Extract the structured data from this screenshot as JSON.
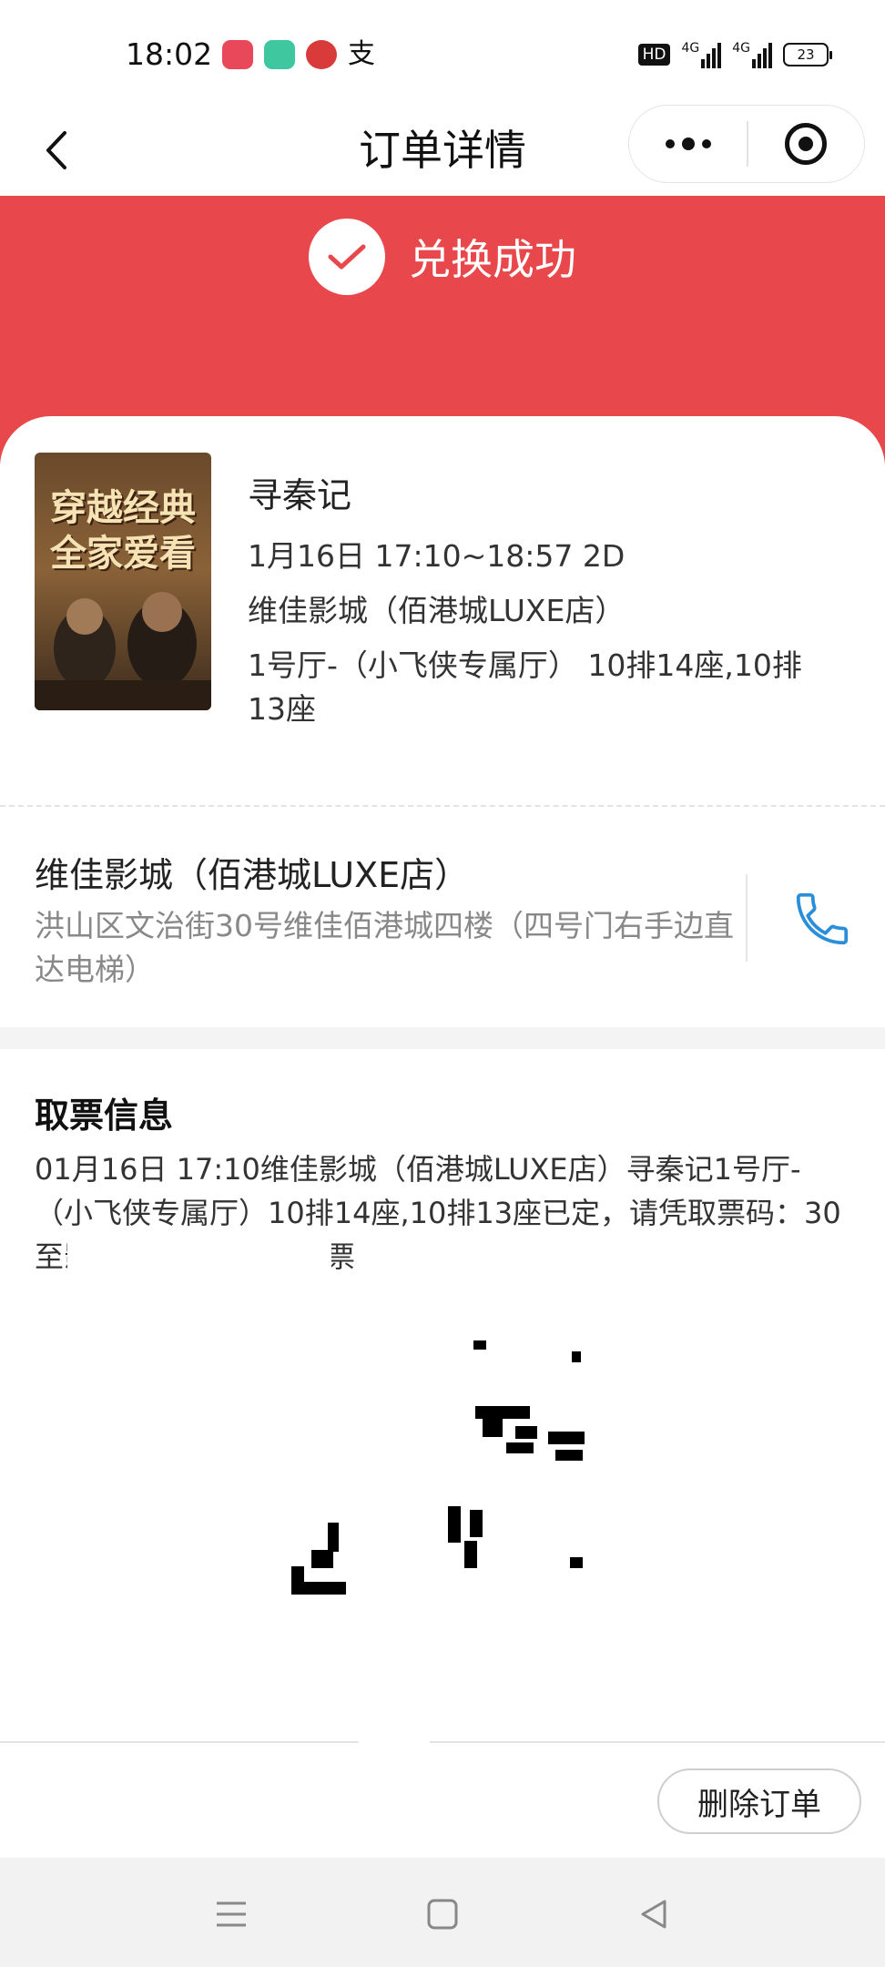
{
  "status_bar": {
    "time": "18:02",
    "notification_icons": [
      "video-app-icon",
      "message-app-icon",
      "bank-app-icon",
      "alipay-icon"
    ],
    "alipay_glyph": "支",
    "hd_label": "HD",
    "network_1": "4G",
    "network_2": "4G",
    "battery": "23"
  },
  "nav": {
    "title": "订单详情",
    "back_icon": "chevron-left-icon",
    "more_icon": "more-dots-icon",
    "close_icon": "target-icon"
  },
  "banner": {
    "status_text": "兑换成功",
    "background": "#e8474b",
    "check_color": "#e8474b"
  },
  "movie": {
    "poster_lines": [
      "穿越经典",
      "全家爱看"
    ],
    "title": "寻秦记",
    "showtime": "1月16日 17:10~18:57 2D",
    "cinema": "维佳影城（佰港城LUXE店）",
    "hall_seats": "1号厅-（小飞侠专属厅） 10排14座,10排13座"
  },
  "cinema": {
    "name": "维佳影城（佰港城LUXE店）",
    "address": "洪山区文治街30号维佳佰港城四楼（四号门右手边直达电梯）",
    "phone_icon": "phone-icon",
    "phone_color": "#2a8fd8"
  },
  "ticket": {
    "heading": "取票信息",
    "message": "01月16日 17:10维佳影城（佰港城LUXE店）寻秦记1号厅-（小飞侠专属厅）10排14座,10排13座已定，请凭取票码：30 至影城自助机或前台取票"
  },
  "actions": {
    "delete_label": "删除订单"
  },
  "system_nav": {
    "menu_icon": "menu-icon",
    "home_icon": "square-home-icon",
    "back_icon": "triangle-back-icon"
  }
}
